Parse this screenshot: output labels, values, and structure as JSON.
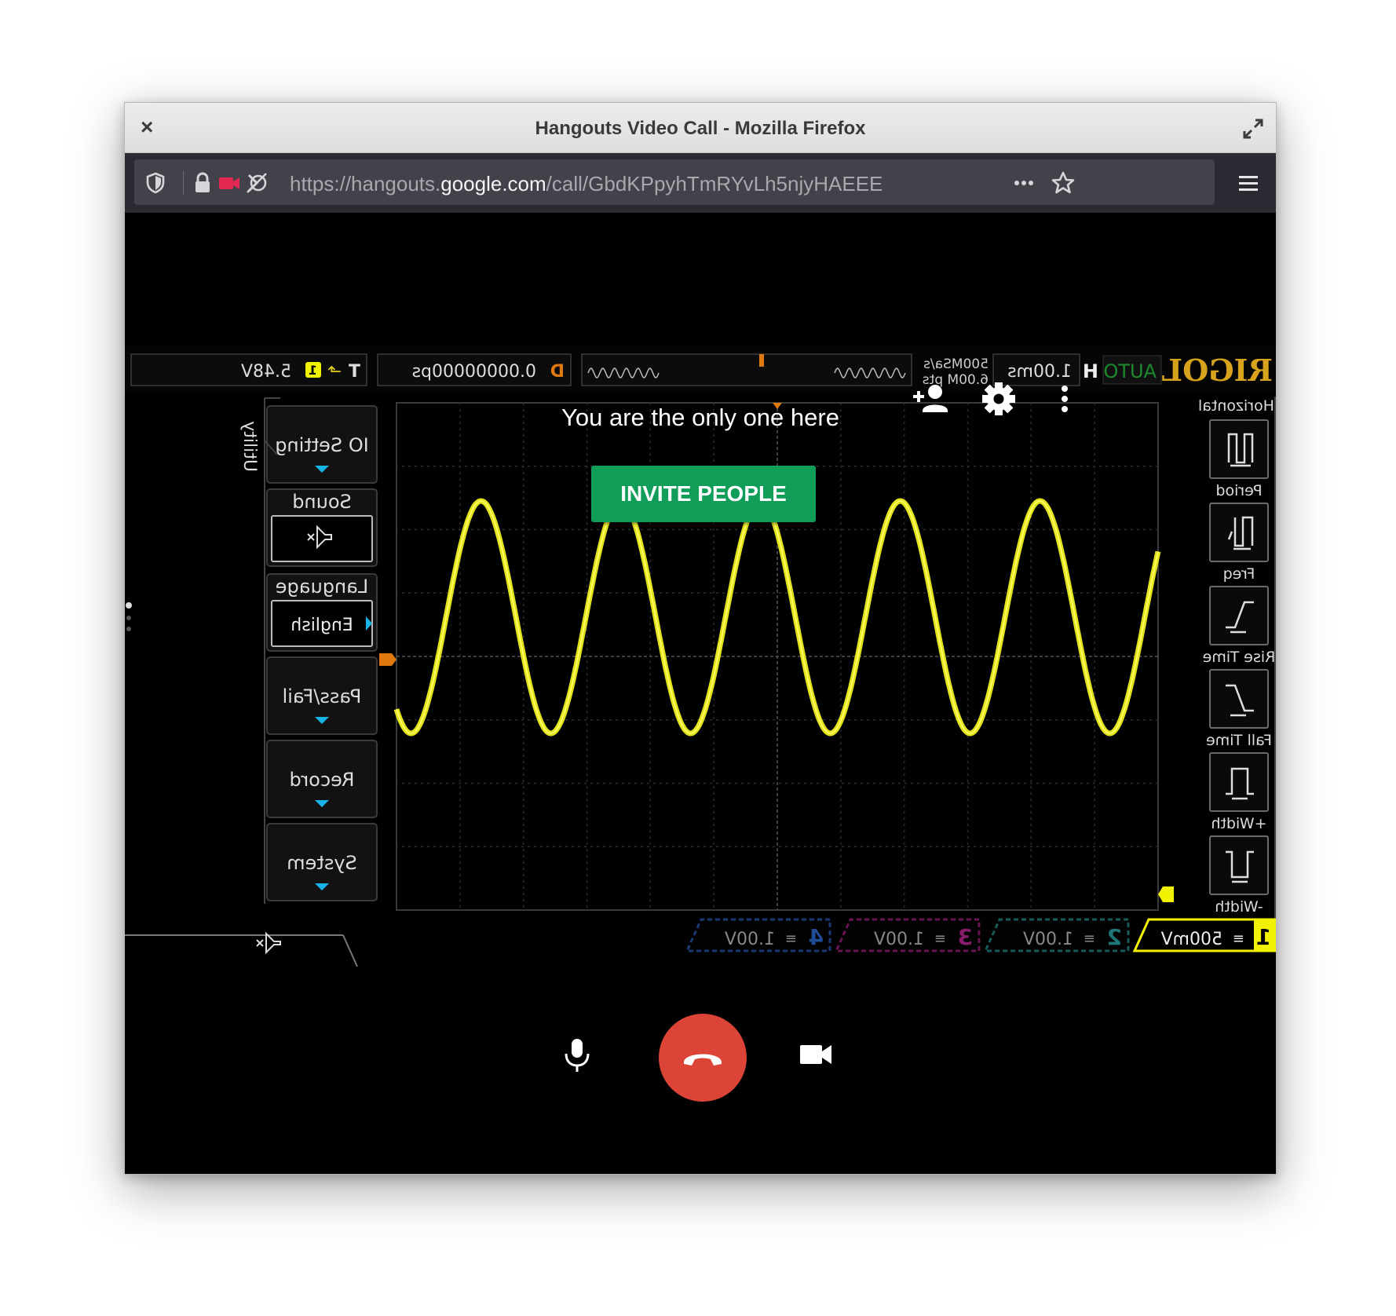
{
  "window": {
    "title": "Hangouts Video Call - Mozilla Firefox",
    "close_glyph": "×"
  },
  "urlbar": {
    "url_prefix": "https://hangouts.",
    "url_domain": "google.com",
    "url_suffix": "/call/GbdKPpyhTmRYvLh5njyHAEEE"
  },
  "call": {
    "status_text": "You are the only one here",
    "invite_label": "INVITE PEOPLE"
  },
  "scope": {
    "brand": "RIGOL",
    "mode": "AUTO",
    "timebase_letter": "H",
    "timebase": "1.00ms",
    "sample_rate": "500MSa/s",
    "mem_depth": "6.00M pts",
    "delay_letter": "D",
    "delay": "0.00000000ps",
    "trig_letter": "T",
    "trig_level": "5.48V",
    "channel_marker": "1",
    "menu_title": "Utility",
    "menu": [
      {
        "label": "IO Setting",
        "value": "",
        "arrow": "down"
      },
      {
        "label": "Sound",
        "value": "speaker",
        "arrow": ""
      },
      {
        "label": "Language",
        "value": "English",
        "arrow": "right"
      },
      {
        "label": "Pass/Fail",
        "value": "",
        "arrow": "down"
      },
      {
        "label": "Record",
        "value": "",
        "arrow": "down"
      },
      {
        "label": "System",
        "value": "",
        "arrow": "down"
      }
    ],
    "measure_title": "Horizontal",
    "measures": [
      "Period",
      "Freq",
      "Rise Time",
      "Fall Time",
      "+Width",
      "-Width"
    ],
    "channels": [
      {
        "num": "1",
        "scale": "500mV",
        "color": "#f2f200"
      },
      {
        "num": "2",
        "scale": "1.00V",
        "color": "#2aa7a7"
      },
      {
        "num": "3",
        "scale": "1.00V",
        "color": "#c0279a"
      },
      {
        "num": "4",
        "scale": "1.00V",
        "color": "#2e6bd6"
      }
    ],
    "trigger_marker": "T",
    "wave_color": "#e3e31c",
    "wave_cycles": 5.45,
    "mirrored": true
  },
  "colors": {
    "invite_green": "#0f9d58",
    "hangup_red": "#db4437",
    "camera_red": "#e22850"
  },
  "icons": {
    "add_person": "add-person-icon",
    "settings": "gear-icon",
    "more": "more-vert-icon",
    "mic": "microphone-icon",
    "hangup": "phone-hangup-icon",
    "camera": "video-camera-icon"
  }
}
